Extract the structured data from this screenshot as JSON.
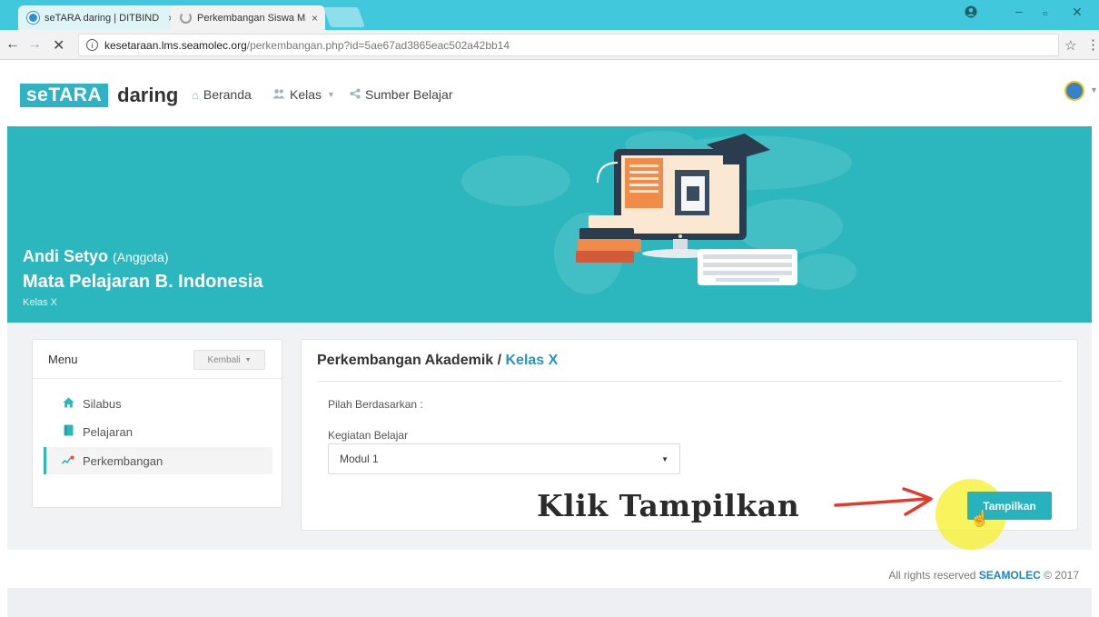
{
  "browser": {
    "tabs": [
      {
        "label": "seTARA daring | DITBIND",
        "close": "×"
      },
      {
        "label": "Perkembangan Siswa Ma",
        "close": "×"
      }
    ],
    "url_host": "kesetaraan.lms.seamolec.org",
    "url_path": "/perkembangan.php?id=5ae67ad3865eac502a42bb14",
    "icons": {
      "back": "back-arrow-icon",
      "forward": "forward-arrow-icon",
      "stop": "close-icon",
      "star": "star-icon",
      "menu": "kebab-menu-icon"
    }
  },
  "navbar": {
    "logo_part1": "seTARA",
    "logo_part2": "daring",
    "items": [
      {
        "label": "Beranda",
        "icon": "home-icon"
      },
      {
        "label": "Kelas",
        "icon": "users-icon"
      },
      {
        "label": "Sumber Belajar",
        "icon": "share-icon"
      }
    ]
  },
  "hero": {
    "student_name": "Andi Setyo",
    "role": "(Anggota)",
    "subject": "Mata Pelajaran B. Indonesia",
    "class": "Kelas X"
  },
  "menu": {
    "title": "Menu",
    "back_button": "Kembali",
    "items": [
      {
        "label": "Silabus",
        "icon": "home-icon",
        "color": "#2bb7bd"
      },
      {
        "label": "Pelajaran",
        "icon": "book-icon",
        "color": "#2bb7bd"
      },
      {
        "label": "Perkembangan",
        "icon": "trend-icon",
        "color": "#2bb7bd",
        "active": true
      }
    ]
  },
  "main": {
    "title_prefix": "Perkembangan Akademik / ",
    "title_accent": "Kelas X",
    "filter_label": "Pilah Berdasarkan :",
    "kegiatan_label": "Kegiatan Belajar",
    "selected_module": "Modul 1",
    "callout_text": "Klik Tampilkan",
    "button_label": "Tampilkan"
  },
  "footer": {
    "prefix": "All rights reserved ",
    "brand": "SEAMOLEC",
    "suffix": " © 2017"
  },
  "colors": {
    "accent": "#2bb7bd",
    "brand_blue": "#1b86b8",
    "highlight": "#f5f028"
  }
}
